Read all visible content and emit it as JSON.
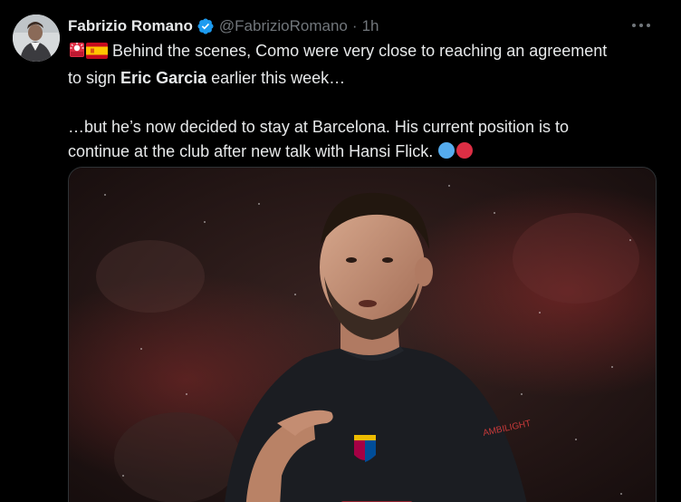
{
  "tweet": {
    "author_name": "Fabrizio Romano",
    "handle": "@FabrizioRomano",
    "separator": "·",
    "time": "1h",
    "line1_text": " Behind the scenes, Como were very close to reaching an agreement",
    "line2_pre": "to sign ",
    "line2_bold": "Eric Garcia",
    "line2_post": " earlier this week…",
    "line3": "…but he’s now decided to stay at Barcelona. His current position is to",
    "line4": "continue at the club after new talk with Hansi Flick. "
  },
  "colors": {
    "background": "#000000",
    "text": "#e7e9ea",
    "muted": "#71767b",
    "verified": "#1d9bf0",
    "blue_circle": "#55acee",
    "red_circle": "#dd2e44"
  },
  "icons": {
    "siren": "police-car-light-icon",
    "flag": "spain-flag-icon",
    "verified": "verified-badge-icon",
    "more": "more-options-icon"
  },
  "media": {
    "description_kind": "photo"
  }
}
